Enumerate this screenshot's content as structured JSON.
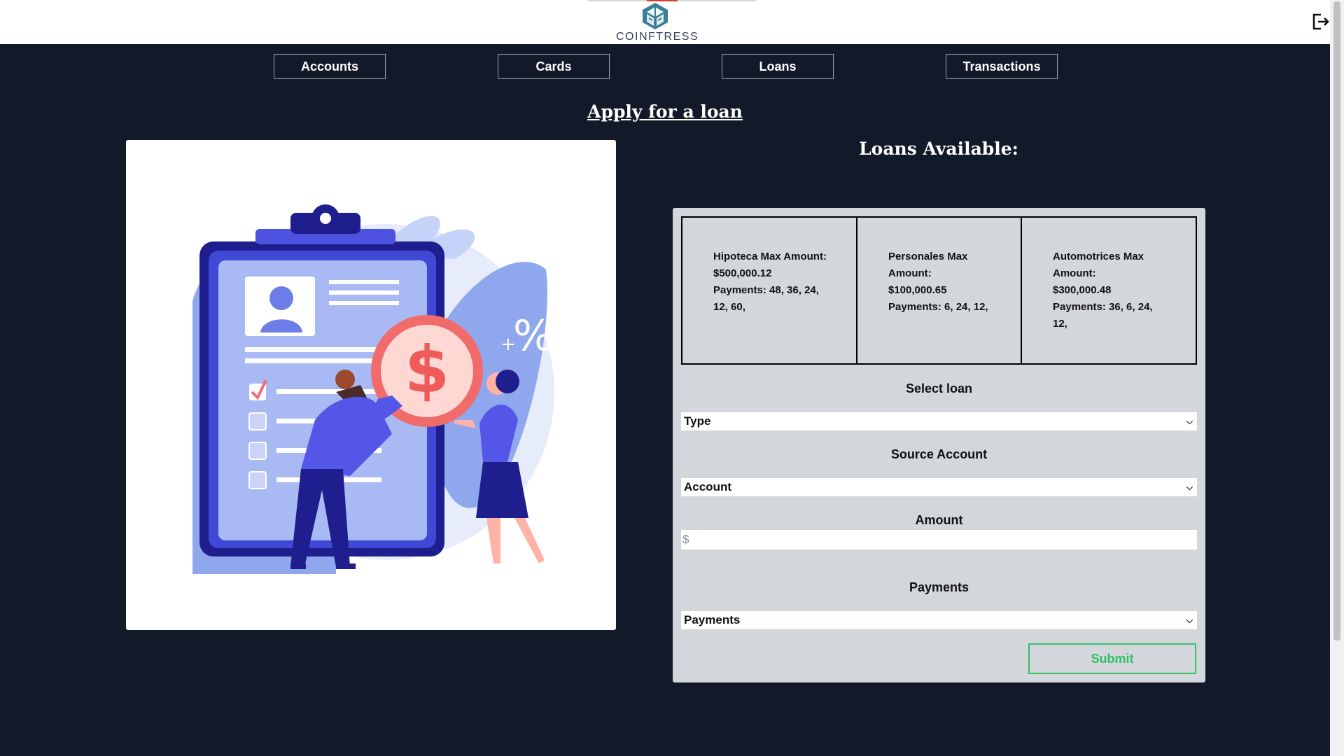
{
  "header": {
    "logo_text": "COINFTRESS",
    "logout_icon": "logout-icon"
  },
  "nav": {
    "items": [
      {
        "label": "Accounts"
      },
      {
        "label": "Cards"
      },
      {
        "label": "Loans"
      },
      {
        "label": "Transactions"
      }
    ]
  },
  "page": {
    "title": "Apply for a loan",
    "illustration": "loan-application-illustration"
  },
  "loans": {
    "heading": "Loans Available:",
    "cards": [
      {
        "title": "Hipoteca Max Amount:",
        "amount": "$500,000.12",
        "payments": "Payments: 48, 36, 24, 12, 60,"
      },
      {
        "title": "Personales Max Amount:",
        "amount": "$100,000.65",
        "payments": "Payments: 6, 24, 12,"
      },
      {
        "title": "Automotrices Max Amount:",
        "amount": "$300,000.48",
        "payments": "Payments: 36, 6, 24, 12,"
      }
    ]
  },
  "form": {
    "loan_label": "Select loan",
    "loan_value": "Type",
    "account_label": "Source Account",
    "account_value": "Account",
    "amount_label": "Amount",
    "amount_placeholder": "$",
    "payments_label": "Payments",
    "payments_value": "Payments",
    "submit_label": "Submit"
  },
  "colors": {
    "background": "#121a29",
    "panel": "#d3d6db",
    "accent_green": "#2fbf66",
    "logo_teal": "#3b7f97"
  }
}
